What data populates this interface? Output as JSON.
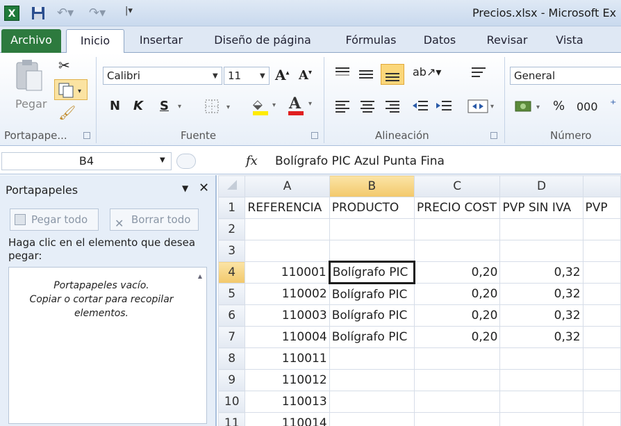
{
  "window": {
    "title": "Precios.xlsx  -  Microsoft Ex"
  },
  "tabs": {
    "archivo": "Archivo",
    "inicio": "Inicio",
    "insertar": "Insertar",
    "diseno": "Diseño de página",
    "formulas": "Fórmulas",
    "datos": "Datos",
    "revisar": "Revisar",
    "vista": "Vista"
  },
  "ribbon": {
    "portapapeles": {
      "label": "Portapape...",
      "pegar": "Pegar"
    },
    "fuente": {
      "label": "Fuente",
      "font": "Calibri",
      "size": "11",
      "bold": "N",
      "italic": "K",
      "underline": "S"
    },
    "alineacion": {
      "label": "Alineación"
    },
    "numero": {
      "label": "Número",
      "format": "General",
      "percent": "%",
      "thousands": "000"
    }
  },
  "formula_bar": {
    "name_box": "B4",
    "fx": "fx",
    "content": "Bolígrafo PIC Azul Punta Fina"
  },
  "pane": {
    "title": "Portapapeles",
    "paste_all": "Pegar todo",
    "clear_all": "Borrar todo",
    "help": "Haga clic en el elemento que desea pegar:",
    "empty_line1": "Portapapeles vacío.",
    "empty_line2": "Copiar o cortar para recopilar elementos."
  },
  "grid": {
    "columns": [
      "A",
      "B",
      "C",
      "D",
      ""
    ],
    "rows": [
      {
        "n": "1",
        "cells": [
          "REFERENCIA",
          "PRODUCTO",
          "PRECIO COST",
          "PVP SIN IVA",
          "PVP"
        ]
      },
      {
        "n": "2",
        "cells": [
          "",
          "",
          "",
          "",
          ""
        ]
      },
      {
        "n": "3",
        "cells": [
          "",
          "",
          "",
          "",
          ""
        ]
      },
      {
        "n": "4",
        "cells": [
          "110001",
          "Bolígrafo PIC",
          "0,20",
          "0,32",
          ""
        ]
      },
      {
        "n": "5",
        "cells": [
          "110002",
          "Bolígrafo PIC",
          "0,20",
          "0,32",
          ""
        ]
      },
      {
        "n": "6",
        "cells": [
          "110003",
          "Bolígrafo PIC",
          "0,20",
          "0,32",
          ""
        ]
      },
      {
        "n": "7",
        "cells": [
          "110004",
          "Bolígrafo PIC",
          "0,20",
          "0,32",
          ""
        ]
      },
      {
        "n": "8",
        "cells": [
          "110011",
          "",
          "",
          "",
          ""
        ]
      },
      {
        "n": "9",
        "cells": [
          "110012",
          "",
          "",
          "",
          ""
        ]
      },
      {
        "n": "10",
        "cells": [
          "110013",
          "",
          "",
          "",
          ""
        ]
      },
      {
        "n": "11",
        "cells": [
          "110014",
          "",
          "",
          "",
          ""
        ]
      }
    ]
  }
}
